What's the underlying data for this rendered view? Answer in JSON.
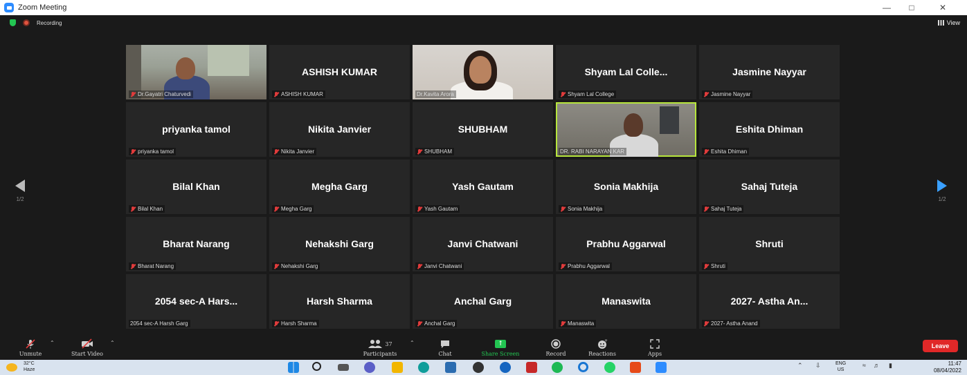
{
  "window": {
    "title": "Zoom Meeting",
    "min_icon": "minimize-icon",
    "restore_icon": "restore-icon",
    "close_icon": "close-icon"
  },
  "meeting": {
    "recording_label": "Recording",
    "view_label": "View",
    "page_indicator_left": "1/2",
    "page_indicator_right": "1/2"
  },
  "tiles": [
    {
      "display": "",
      "label": "Dr.Gayatri Chaturvedi",
      "video": "video1",
      "muted": true
    },
    {
      "display": "ASHISH KUMAR",
      "label": "ASHISH KUMAR",
      "muted": true
    },
    {
      "display": "",
      "label": "Dr.Kavita Arora",
      "video": "video2",
      "muted": false
    },
    {
      "display": "Shyam Lal Colle...",
      "label": "Shyam Lal College",
      "muted": true
    },
    {
      "display": "Jasmine Nayyar",
      "label": "Jasmine Nayyar",
      "muted": true
    },
    {
      "display": "priyanka tamol",
      "label": "priyanka tamol",
      "muted": true
    },
    {
      "display": "Nikita Janvier",
      "label": "Nikita Janvier",
      "muted": true
    },
    {
      "display": "SHUBHAM",
      "label": "SHUBHAM",
      "muted": true
    },
    {
      "display": "",
      "label": "DR. RABI NARAYAN KAR",
      "video": "video3",
      "muted": false
    },
    {
      "display": "Eshita Dhiman",
      "label": "Eshita Dhiman",
      "muted": true
    },
    {
      "display": "Bilal Khan",
      "label": "Bilal Khan",
      "muted": true
    },
    {
      "display": "Megha Garg",
      "label": "Megha Garg",
      "muted": true
    },
    {
      "display": "Yash Gautam",
      "label": "Yash Gautam",
      "muted": true
    },
    {
      "display": "Sonia Makhija",
      "label": "Sonia Makhija",
      "muted": true
    },
    {
      "display": "Sahaj Tuteja",
      "label": "Sahaj Tuteja",
      "muted": true
    },
    {
      "display": "Bharat Narang",
      "label": "Bharat Narang",
      "muted": true
    },
    {
      "display": "Nehakshi Garg",
      "label": "Nehakshi Garg",
      "muted": true
    },
    {
      "display": "Janvi Chatwani",
      "label": "Janvi Chatwani",
      "muted": true
    },
    {
      "display": "Prabhu Aggarwal",
      "label": "Prabhu Aggarwal",
      "muted": true
    },
    {
      "display": "Shruti",
      "label": "Shruti",
      "muted": true
    },
    {
      "display": "2054 sec-A Hars...",
      "label": "2054 sec-A Harsh Garg",
      "muted": false
    },
    {
      "display": "Harsh Sharma",
      "label": "Harsh Sharma",
      "muted": true
    },
    {
      "display": "Anchal Garg",
      "label": "Anchal Garg",
      "muted": true
    },
    {
      "display": "Manaswita",
      "label": "Manaswita",
      "muted": true
    },
    {
      "display": "2027- Astha An...",
      "label": "2027- Astha Anand",
      "muted": true
    }
  ],
  "toolbar": {
    "unmute": "Unmute",
    "start_video": "Start Video",
    "participants": "Participants",
    "participants_count": "37",
    "chat": "Chat",
    "share_screen": "Share Screen",
    "record": "Record",
    "reactions": "Reactions",
    "apps": "Apps",
    "leave": "Leave"
  },
  "taskbar": {
    "temperature": "32°C",
    "weather": "Haze",
    "lang_top": "ENG",
    "lang_bottom": "US",
    "time": "11:47",
    "date": "08/04/2022"
  },
  "colors": {
    "accent_green": "#23c552",
    "leave_red": "#e02828",
    "active_speaker": "#b7e63c",
    "zoom_blue": "#2d8cff"
  }
}
